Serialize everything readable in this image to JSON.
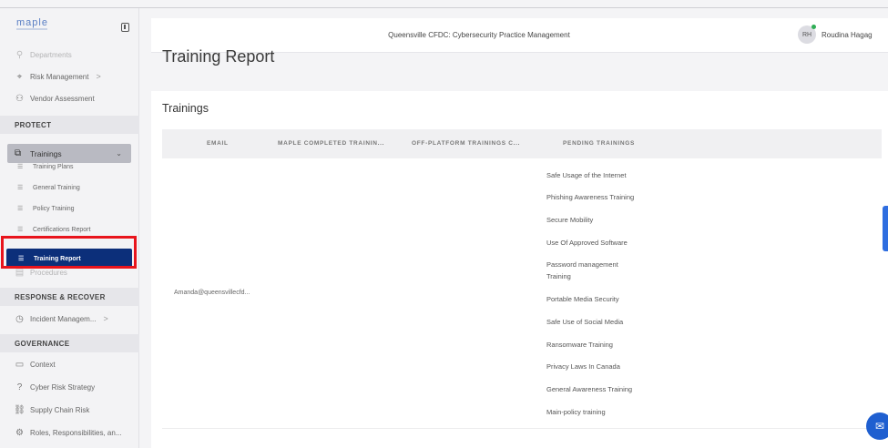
{
  "sidebar": {
    "logo": "maple",
    "partial_top": "Departments",
    "items_top": [
      {
        "label": "Risk Management",
        "icon": "radar-icon",
        "chevron": ">"
      },
      {
        "label": "Vendor Assessment",
        "icon": "people-icon",
        "chevron": ""
      }
    ],
    "sections": {
      "protect": "PROTECT",
      "response": "RESPONSE & RECOVER",
      "governance": "GOVERNANCE"
    },
    "trainings": {
      "label": "Trainings",
      "chevron": "⌄"
    },
    "training_subitems": [
      "Training Plans",
      "General Training",
      "Policy Training",
      "Certifications Report"
    ],
    "active_subitem": "Training Report",
    "procedures": "Procedures",
    "incident": {
      "label": "Incident Managem...",
      "chevron": ">"
    },
    "governance_items": [
      "Context",
      "Cyber Risk Strategy",
      "Supply Chain Risk",
      "Roles, Responsibilities, an..."
    ]
  },
  "header": {
    "title": "Queensville CFDC: Cybersecurity Practice Management",
    "avatar_initials": "RH",
    "user_name": "Roudina Hagag"
  },
  "page": {
    "title": "Training Report",
    "card_title": "Trainings"
  },
  "table": {
    "columns": [
      "EMAIL",
      "MAPLE COMPLETED TRAININ...",
      "OFF-PLATFORM TRAININGS C...",
      "PENDING TRAININGS"
    ],
    "email": "Amanda@queensvillecfd...",
    "pending": [
      "Safe Usage of the Internet",
      "Phishing Awareness Training",
      "Secure Mobility",
      "Use Of Approved Software",
      "Password management",
      "Training",
      "Portable Media Security",
      "Safe Use of Social Media",
      "Ransomware Training",
      "Privacy Laws In Canada",
      "General Awareness Training",
      "Main-policy training"
    ]
  },
  "colors": {
    "active_bg": "#0c2f7a",
    "highlight": "#e8141c",
    "chat": "#1f5fd0"
  }
}
